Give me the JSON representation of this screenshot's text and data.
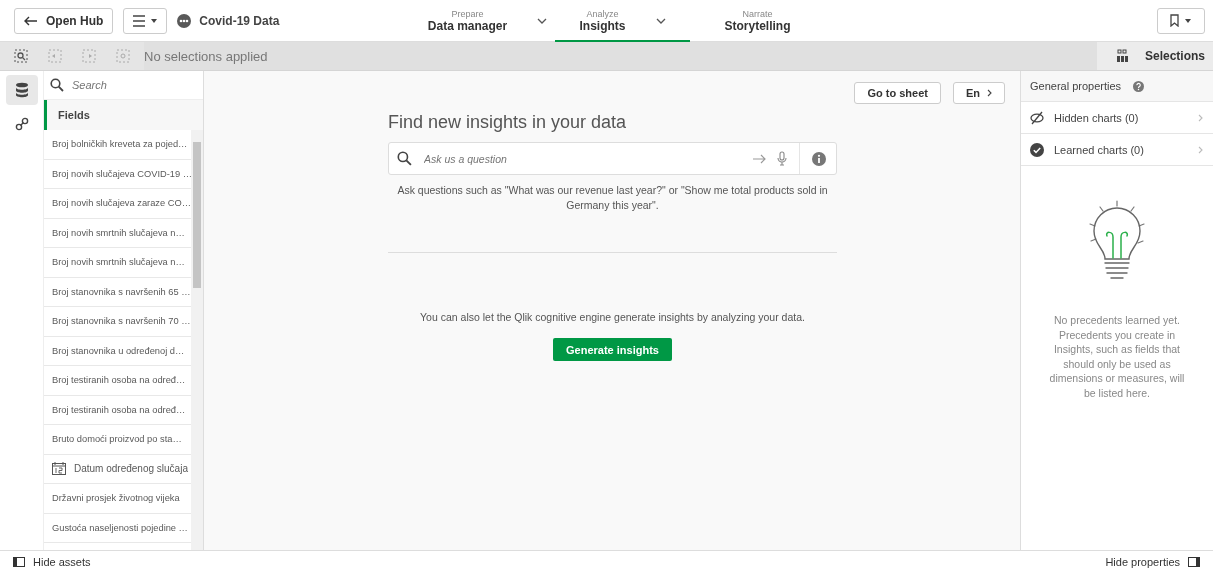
{
  "toolbar": {
    "open_hub": "Open Hub",
    "app_name": "Covid-19 Data",
    "nav": [
      {
        "caption": "Prepare",
        "label": "Data manager",
        "has_menu": true,
        "selected": false
      },
      {
        "caption": "Analyze",
        "label": "Insights",
        "has_menu": true,
        "selected": true
      },
      {
        "caption": "Narrate",
        "label": "Storytelling",
        "has_menu": false,
        "selected": false
      }
    ]
  },
  "selection_bar": {
    "status": "No selections applied",
    "selections_label": "Selections"
  },
  "rail": [
    {
      "kind": "data",
      "selected": true
    },
    {
      "kind": "link",
      "selected": false
    }
  ],
  "assets": {
    "search_placeholder": "Search",
    "tab": "Fields",
    "fields": [
      {
        "kind": "text",
        "label": "Broj bolničkih kreveta za pojed…"
      },
      {
        "kind": "text",
        "label": "Broj novih slučajeva COVID-19 …"
      },
      {
        "kind": "text",
        "label": "Broj novih slučajeva zaraze CO…"
      },
      {
        "kind": "text",
        "label": "Broj novih smrtnih slučajeva n…"
      },
      {
        "kind": "text",
        "label": "Broj novih smrtnih slučajeva n…"
      },
      {
        "kind": "text",
        "label": "Broj stanovnika s navršenih 65 …"
      },
      {
        "kind": "text",
        "label": "Broj stanovnika s navršenih 70 …"
      },
      {
        "kind": "text",
        "label": "Broj stanovnika u određenoj d…"
      },
      {
        "kind": "text",
        "label": "Broj testiranih osoba na određ…"
      },
      {
        "kind": "text",
        "label": "Broj testiranih osoba na određ…"
      },
      {
        "kind": "text",
        "label": "Bruto domoći proizvod po sta…"
      },
      {
        "kind": "date",
        "label": "Datum određenog slučaja"
      },
      {
        "kind": "text",
        "label": "Državni prosjek životnog vijeka"
      },
      {
        "kind": "text",
        "label": "Gustoća naseljenosti pojedine …"
      }
    ]
  },
  "center": {
    "go_to_sheet": "Go to sheet",
    "language": "En",
    "heading": "Find new insights in your data",
    "ask_placeholder": "Ask us a question",
    "hint": "Ask questions such as \"What was our revenue last year?\" or \"Show me total products sold in Germany this year\".",
    "engine_text": "You can also let the Qlik cognitive engine generate insights by analyzing your data.",
    "generate_button": "Generate insights"
  },
  "properties": {
    "title": "General properties",
    "rows": [
      {
        "kind": "hidden",
        "label": "Hidden charts (0)"
      },
      {
        "kind": "learned",
        "label": "Learned charts (0)"
      }
    ],
    "empty_text": "No precedents learned yet. Precedents you create in Insights, such as fields that should only be used as dimensions or measures, will be listed here."
  },
  "footer": {
    "hide_assets": "Hide assets",
    "hide_properties": "Hide properties"
  }
}
